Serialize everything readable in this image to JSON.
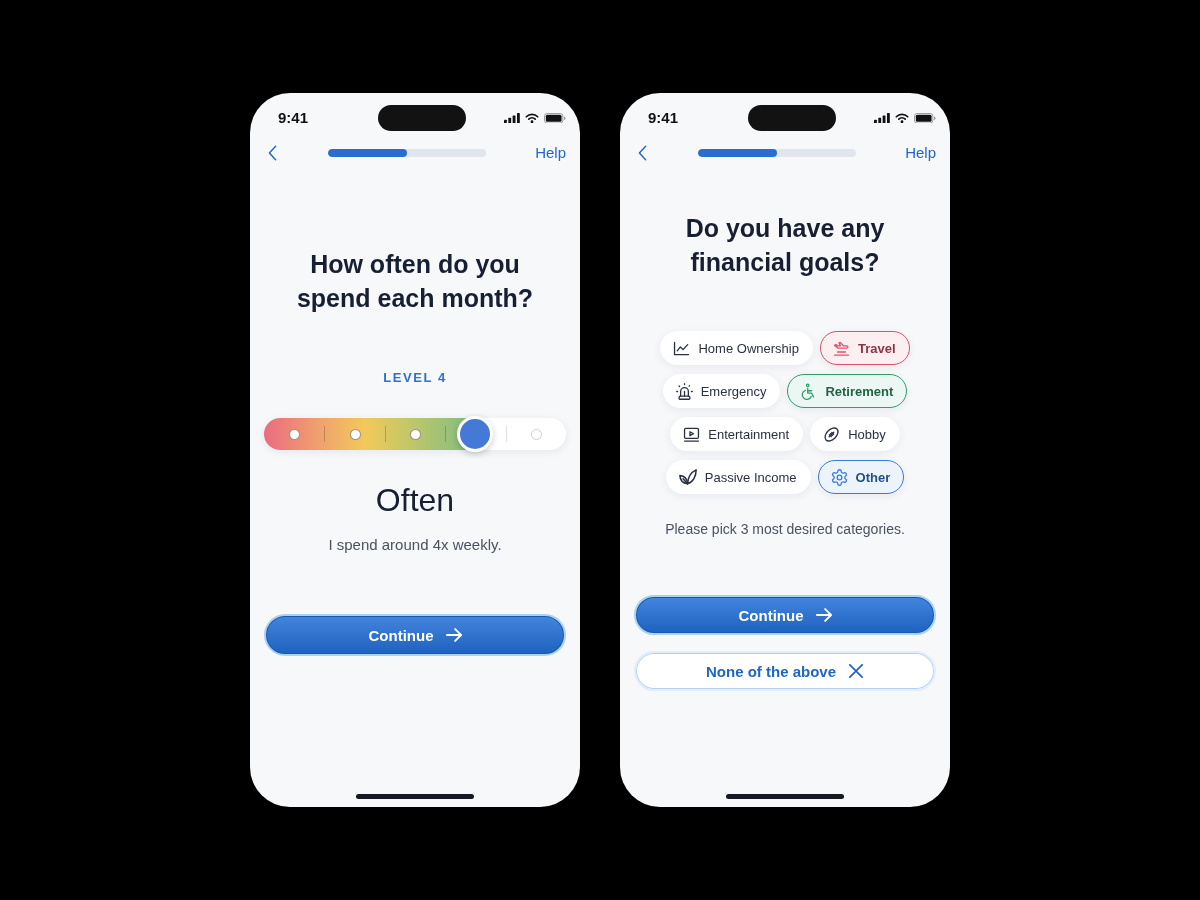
{
  "screens": [
    {
      "kind": "level",
      "status_bar": {
        "time": "9:41"
      },
      "nav": {
        "progress": {
          "level": 0.5
        },
        "help": "Help"
      },
      "title": "How often do you spend each month?",
      "level_label": "LEVEL 4",
      "slider": {
        "level": 0.7
      },
      "answer": "Often",
      "description": "I spend around 4x weekly.",
      "buttons": [
        {
          "kind": "primary",
          "label": "Continue"
        }
      ]
    },
    {
      "kind": "chips",
      "status_bar": {
        "time": "9:41"
      },
      "nav": {
        "progress": {
          "level": 0.5
        },
        "help": "Help"
      },
      "title": "Do you have any financial goals?",
      "chips": [
        {
          "label": "Home Ownership",
          "selected": false
        },
        {
          "label": "Travel",
          "selected": true,
          "color": "#e0506a"
        },
        {
          "label": "Emergency",
          "selected": false
        },
        {
          "label": "Retirement",
          "selected": true,
          "color": "#2f9e6a"
        },
        {
          "label": "Entertainment",
          "selected": false
        },
        {
          "label": "Hobby",
          "selected": false
        },
        {
          "label": "Passive Income",
          "selected": false
        },
        {
          "label": "Other",
          "selected": true,
          "color": "#3a7bd5"
        }
      ],
      "hint": "Please pick 3 most desired categories.",
      "buttons": [
        {
          "kind": "primary",
          "label": "Continue"
        },
        {
          "kind": "secondary",
          "label": "None of the above"
        }
      ]
    }
  ]
}
